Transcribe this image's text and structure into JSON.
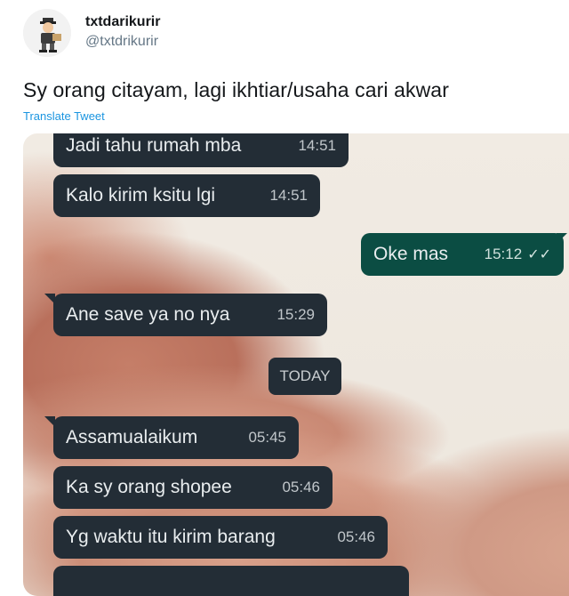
{
  "tweet": {
    "display_name": "txtdarikurir",
    "handle": "@txtdrikurir",
    "text": "Sy orang citayam, lagi ikhtiar/usaha cari akwar",
    "translate_label": "Translate Tweet"
  },
  "chat": {
    "messages": [
      {
        "text": "Jadi tahu rumah mba",
        "time": "14:51",
        "direction": "in"
      },
      {
        "text": "Kalo kirim ksitu lgi",
        "time": "14:51",
        "direction": "in"
      },
      {
        "text": "Oke mas",
        "time": "15:12",
        "direction": "out",
        "status": "read"
      },
      {
        "text": "Ane save ya no nya",
        "time": "15:29",
        "direction": "in"
      },
      {
        "text": "Assamualaikum",
        "time": "05:45",
        "direction": "in"
      },
      {
        "text": "Ka sy orang shopee",
        "time": "05:46",
        "direction": "in"
      },
      {
        "text": "Yg waktu itu kirim barang",
        "time": "05:46",
        "direction": "in"
      }
    ],
    "day_label": "TODAY"
  },
  "colors": {
    "incoming_bubble": "#232d36",
    "outgoing_bubble": "#0b4d43",
    "link": "#1b95e0"
  }
}
